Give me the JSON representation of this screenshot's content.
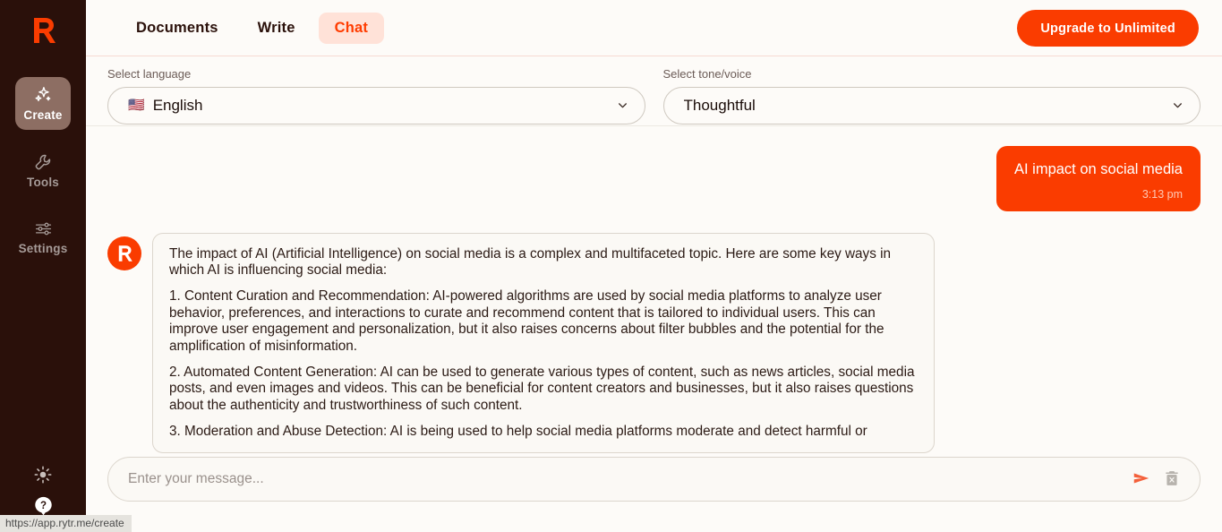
{
  "colors": {
    "brand_orange": "#FA3C00",
    "sidebar_bg": "#2A100A",
    "page_bg": "#FDFBF8",
    "active_tab_bg": "#FFE2D8",
    "create_active_bg": "#8D6E63"
  },
  "sidebar": {
    "logo_alt": "rytr-logo",
    "items": [
      {
        "label": "Create",
        "icon": "sparkles-icon",
        "active": true
      },
      {
        "label": "Tools",
        "icon": "wrench-icon",
        "active": false
      },
      {
        "label": "Settings",
        "icon": "sliders-icon",
        "active": false
      }
    ],
    "bottom_items": [
      {
        "name": "theme-toggle",
        "icon": "sun-icon"
      },
      {
        "name": "help",
        "icon": "question-mark-icon"
      }
    ]
  },
  "topbar": {
    "tabs": [
      {
        "label": "Documents",
        "active": false
      },
      {
        "label": "Write",
        "active": false
      },
      {
        "label": "Chat",
        "active": true
      }
    ],
    "upgrade_label": "Upgrade to Unlimited"
  },
  "selectors": {
    "language": {
      "label": "Select language",
      "value": "English",
      "flag": "🇺🇸"
    },
    "tone": {
      "label": "Select tone/voice",
      "value": "Thoughtful"
    }
  },
  "conversation": {
    "user_message": {
      "text": "AI impact on social media",
      "time": "3:13 pm"
    },
    "bot_message": {
      "avatar_letter": "R",
      "paragraphs": [
        "The impact of AI (Artificial Intelligence) on social media is a complex and multifaceted topic. Here are some key ways in which AI is influencing social media:",
        "1. Content Curation and Recommendation: AI-powered algorithms are used by social media platforms to analyze user behavior, preferences, and interactions to curate and recommend content that is tailored to individual users. This can improve user engagement and personalization, but it also raises concerns about filter bubbles and the potential for the amplification of misinformation.",
        "2. Automated Content Generation: AI can be used to generate various types of content, such as news articles, social media posts, and even images and videos. This can be beneficial for content creators and businesses, but it also raises questions about the authenticity and trustworthiness of such content.",
        "3. Moderation and Abuse Detection: AI is being used to help social media platforms moderate and detect harmful or"
      ]
    }
  },
  "composer": {
    "placeholder": "Enter your message...",
    "value": "",
    "send_icon": "send-icon",
    "clear_icon": "trash-icon"
  },
  "status_bar": {
    "url": "https://app.rytr.me/create"
  }
}
